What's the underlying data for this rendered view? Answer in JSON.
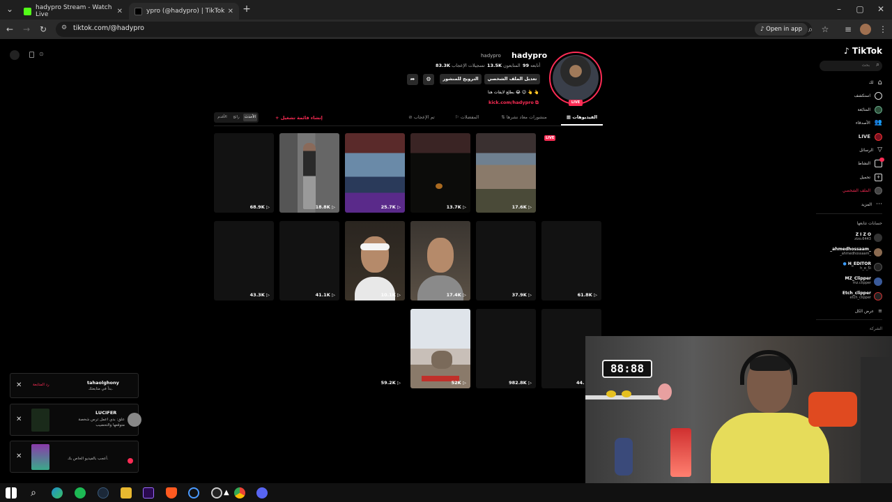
{
  "browser": {
    "tabs": [
      {
        "title": "hadypro Stream - Watch Live",
        "favicon_color": "#53fc18"
      },
      {
        "title": "ypro (@hadypro) | TikTok",
        "favicon_color": "#000000"
      }
    ],
    "new_tab": "+",
    "url": "tiktok.com/@hadypro",
    "open_in_app": "Open in app",
    "window_controls": [
      "–",
      "▢",
      "✕"
    ]
  },
  "sidebar": {
    "logo": "TikTok",
    "search_placeholder": "بحث",
    "items": [
      {
        "label": "لك",
        "icon": "home-icon"
      },
      {
        "label": "استكشف",
        "icon": "compass-icon"
      },
      {
        "label": "المتابَعة",
        "icon": "following-icon"
      },
      {
        "label": "الأصدقاء",
        "icon": "friends-icon"
      },
      {
        "label": "LIVE",
        "icon": "live-icon"
      },
      {
        "label": "الرسائل",
        "icon": "messages-icon"
      },
      {
        "label": "النشاط",
        "icon": "activity-icon"
      },
      {
        "label": "تحميل",
        "icon": "upload-icon"
      },
      {
        "label": "الملف الشخصي",
        "icon": "profile-icon"
      },
      {
        "label": "المزيد",
        "icon": "more-icon"
      }
    ],
    "following_title": "حسابات تتابعها",
    "following": [
      {
        "name": "Z I Z O",
        "handle": "zizo.6443"
      },
      {
        "name": "_ahmedhossaam_",
        "handle": "_ahmedhossaam_"
      },
      {
        "name": "H_EDITOR",
        "handle": "h_e_5i"
      },
      {
        "name": "MZ_Clipper",
        "handle": "mz.clipper"
      },
      {
        "name": "Etch_clipper",
        "handle": "etch_clipper"
      }
    ],
    "see_all": "عرض الكل",
    "company": "الشركة"
  },
  "profile": {
    "username": "hadypro",
    "display_name": "hadypro",
    "stats": [
      {
        "value": "99",
        "label": "أتابعه"
      },
      {
        "value": "13.5K",
        "label": "المتابعون"
      },
      {
        "value": "83.3K",
        "label": "تسجيلات الإعجاب"
      }
    ],
    "edit_button": "تعديل الملف الشخصي",
    "promote_button": "الترويج للمنشور",
    "bio": "بطلع لايفات هنا 😂 😉 👆 👆",
    "link": "kick.com/hadypro",
    "live_badge": "LIVE"
  },
  "tabs": [
    {
      "label": "الفيديوهات",
      "active": true
    },
    {
      "label": "منشورات معاد نشرها",
      "active": false
    },
    {
      "label": "المفضلات",
      "active": false
    },
    {
      "label": "تم الإعجاب",
      "active": false
    }
  ],
  "create_playlist": "+ إنشاء قائمة تشغيل",
  "sort": [
    "الأحدث",
    "رائج",
    "الأقدم"
  ],
  "videos": [
    {
      "views": "",
      "live": true
    },
    {
      "views": "17.6K"
    },
    {
      "views": "13.7K"
    },
    {
      "views": "25.7K"
    },
    {
      "views": "18.8K"
    },
    {
      "views": "68.9K"
    },
    {
      "views": "61.8K"
    },
    {
      "views": "37.9K"
    },
    {
      "views": "17.4K"
    },
    {
      "views": "10.1K"
    },
    {
      "views": "41.1K"
    },
    {
      "views": "43.3K"
    },
    {
      "views": "44."
    },
    {
      "views": "982.8K"
    },
    {
      "views": "52K"
    },
    {
      "views": "59.2K"
    }
  ],
  "notifications": [
    {
      "user": "tahaolghony",
      "text": "بدأ في متابعتك.",
      "action": "رد المتابعة"
    },
    {
      "user": "LUCIFER",
      "text": "علق: بدي اعمل ترس شخصة متوقعها والتحضيب"
    },
    {
      "user": "",
      "text": "أعجب بالفيديو الخاص بك."
    }
  ],
  "webcam": {
    "clock": "88:88"
  },
  "taskbar": {
    "icons": [
      "windows-icon",
      "search-icon",
      "edge-icon",
      "spotify-icon",
      "steam-icon",
      "explorer-icon",
      "premiere-icon",
      "brave-icon",
      "app-icon",
      "obs-icon",
      "chrome-icon",
      "discord-icon"
    ]
  }
}
